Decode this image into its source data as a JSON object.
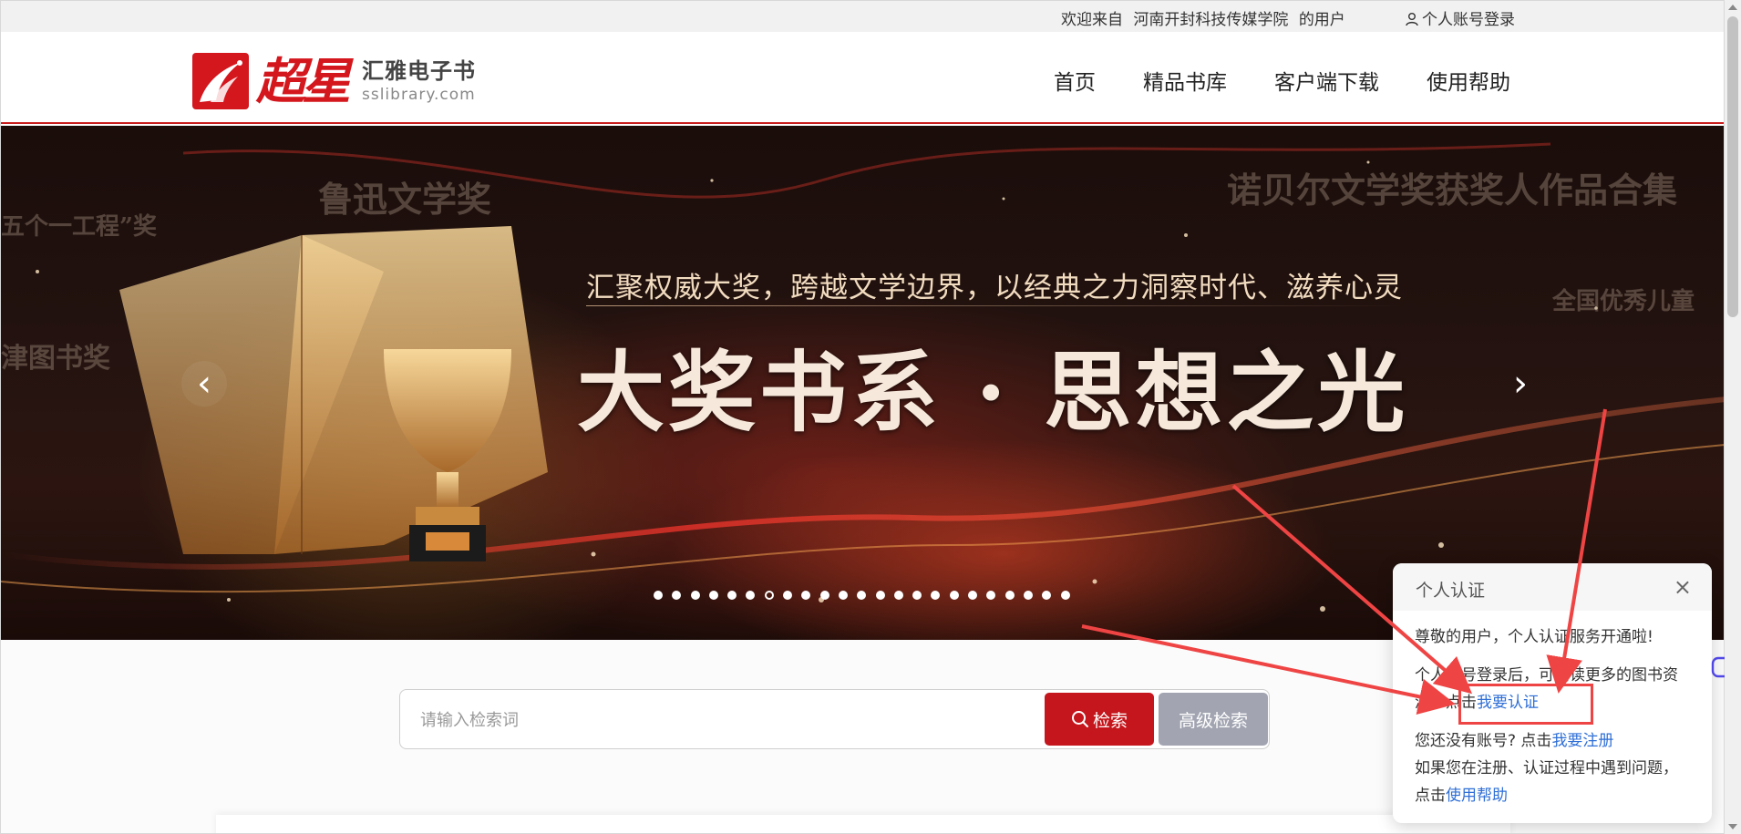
{
  "topbar": {
    "welcome_prefix": "欢迎来自",
    "institution": "河南开封科技传媒学院",
    "welcome_suffix": "的用户",
    "login_label": "个人账号登录"
  },
  "header": {
    "logo_script": "超星",
    "logo_cn": "汇雅电子书",
    "logo_en": "sslibrary.com",
    "nav": [
      "首页",
      "精品书库",
      "客户端下载",
      "使用帮助"
    ]
  },
  "banner": {
    "subtitle": "汇聚权威大奖，跨越文学边界，以经典之力洞察时代、滋养心灵",
    "title": "大奖书系 · 思想之光",
    "background_awards": [
      "鲁迅文学奖",
      "五个一工程”奖",
      "津图书奖",
      "诺贝尔文学奖获奖人作品合集",
      "全国优秀儿童"
    ],
    "prev_label": "‹",
    "next_label": "›",
    "slide_count": 23,
    "active_slide": 6
  },
  "search": {
    "placeholder": "请输入检索词",
    "search_label": "检索",
    "advanced_label": "高级检索"
  },
  "popup": {
    "title": "个人认证",
    "close": "×",
    "line1": "尊敬的用户，个人认证服务开通啦!",
    "line2_prefix": "个人账号登录后，可阅读更多的图书资源，点击",
    "line2_link": "我要认证",
    "line3_prefix": "您还没有账号? 点击",
    "line3_link": "我要注册",
    "line4_prefix": "如果您在注册、认证过程中遇到问题，点击",
    "line4_link": "使用帮助"
  },
  "colors": {
    "brand_red": "#c4161c",
    "annotation_red": "#ef4444",
    "link_blue": "#2f6fd6",
    "advanced_gray": "#a2a5b1"
  }
}
